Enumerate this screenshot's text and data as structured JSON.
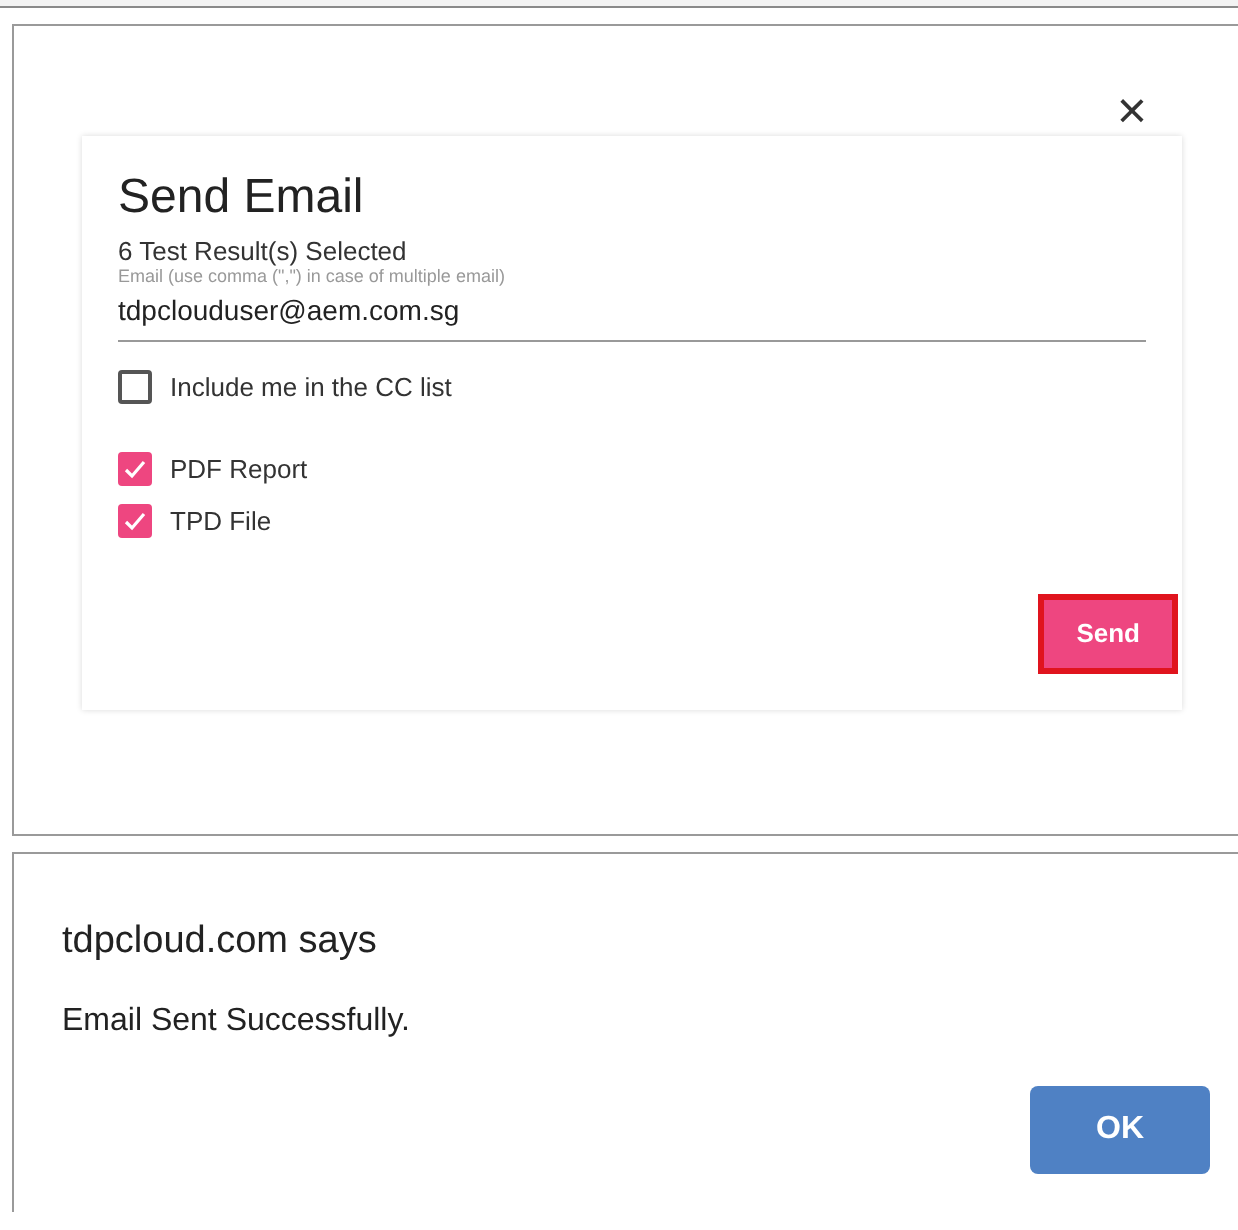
{
  "email_dialog": {
    "close": "×",
    "title": "Send Email",
    "selection_count": "6 Test Result(s) Selected",
    "email_field": {
      "label": "Email (use comma (\",\") in case of multiple email)",
      "value": "tdpclouduser@aem.com.sg"
    },
    "options": [
      {
        "label": "Include me in the CC list",
        "checked": false
      },
      {
        "label": "PDF Report",
        "checked": true
      },
      {
        "label": "TPD File",
        "checked": true
      }
    ],
    "send_button": {
      "label": "Send",
      "highlighted": true
    }
  },
  "alert": {
    "title": "tdpcloud.com says",
    "message": "Email Sent Successfully.",
    "ok_button": "OK"
  }
}
